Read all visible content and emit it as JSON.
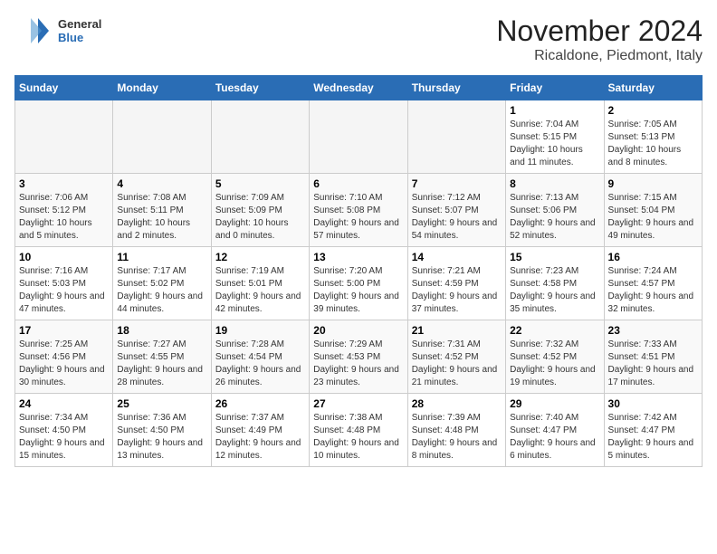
{
  "header": {
    "logo_general": "General",
    "logo_blue": "Blue",
    "month_title": "November 2024",
    "location": "Ricaldone, Piedmont, Italy"
  },
  "weekdays": [
    "Sunday",
    "Monday",
    "Tuesday",
    "Wednesday",
    "Thursday",
    "Friday",
    "Saturday"
  ],
  "weeks": [
    [
      {
        "day": "",
        "info": ""
      },
      {
        "day": "",
        "info": ""
      },
      {
        "day": "",
        "info": ""
      },
      {
        "day": "",
        "info": ""
      },
      {
        "day": "",
        "info": ""
      },
      {
        "day": "1",
        "info": "Sunrise: 7:04 AM\nSunset: 5:15 PM\nDaylight: 10 hours and 11 minutes."
      },
      {
        "day": "2",
        "info": "Sunrise: 7:05 AM\nSunset: 5:13 PM\nDaylight: 10 hours and 8 minutes."
      }
    ],
    [
      {
        "day": "3",
        "info": "Sunrise: 7:06 AM\nSunset: 5:12 PM\nDaylight: 10 hours and 5 minutes."
      },
      {
        "day": "4",
        "info": "Sunrise: 7:08 AM\nSunset: 5:11 PM\nDaylight: 10 hours and 2 minutes."
      },
      {
        "day": "5",
        "info": "Sunrise: 7:09 AM\nSunset: 5:09 PM\nDaylight: 10 hours and 0 minutes."
      },
      {
        "day": "6",
        "info": "Sunrise: 7:10 AM\nSunset: 5:08 PM\nDaylight: 9 hours and 57 minutes."
      },
      {
        "day": "7",
        "info": "Sunrise: 7:12 AM\nSunset: 5:07 PM\nDaylight: 9 hours and 54 minutes."
      },
      {
        "day": "8",
        "info": "Sunrise: 7:13 AM\nSunset: 5:06 PM\nDaylight: 9 hours and 52 minutes."
      },
      {
        "day": "9",
        "info": "Sunrise: 7:15 AM\nSunset: 5:04 PM\nDaylight: 9 hours and 49 minutes."
      }
    ],
    [
      {
        "day": "10",
        "info": "Sunrise: 7:16 AM\nSunset: 5:03 PM\nDaylight: 9 hours and 47 minutes."
      },
      {
        "day": "11",
        "info": "Sunrise: 7:17 AM\nSunset: 5:02 PM\nDaylight: 9 hours and 44 minutes."
      },
      {
        "day": "12",
        "info": "Sunrise: 7:19 AM\nSunset: 5:01 PM\nDaylight: 9 hours and 42 minutes."
      },
      {
        "day": "13",
        "info": "Sunrise: 7:20 AM\nSunset: 5:00 PM\nDaylight: 9 hours and 39 minutes."
      },
      {
        "day": "14",
        "info": "Sunrise: 7:21 AM\nSunset: 4:59 PM\nDaylight: 9 hours and 37 minutes."
      },
      {
        "day": "15",
        "info": "Sunrise: 7:23 AM\nSunset: 4:58 PM\nDaylight: 9 hours and 35 minutes."
      },
      {
        "day": "16",
        "info": "Sunrise: 7:24 AM\nSunset: 4:57 PM\nDaylight: 9 hours and 32 minutes."
      }
    ],
    [
      {
        "day": "17",
        "info": "Sunrise: 7:25 AM\nSunset: 4:56 PM\nDaylight: 9 hours and 30 minutes."
      },
      {
        "day": "18",
        "info": "Sunrise: 7:27 AM\nSunset: 4:55 PM\nDaylight: 9 hours and 28 minutes."
      },
      {
        "day": "19",
        "info": "Sunrise: 7:28 AM\nSunset: 4:54 PM\nDaylight: 9 hours and 26 minutes."
      },
      {
        "day": "20",
        "info": "Sunrise: 7:29 AM\nSunset: 4:53 PM\nDaylight: 9 hours and 23 minutes."
      },
      {
        "day": "21",
        "info": "Sunrise: 7:31 AM\nSunset: 4:52 PM\nDaylight: 9 hours and 21 minutes."
      },
      {
        "day": "22",
        "info": "Sunrise: 7:32 AM\nSunset: 4:52 PM\nDaylight: 9 hours and 19 minutes."
      },
      {
        "day": "23",
        "info": "Sunrise: 7:33 AM\nSunset: 4:51 PM\nDaylight: 9 hours and 17 minutes."
      }
    ],
    [
      {
        "day": "24",
        "info": "Sunrise: 7:34 AM\nSunset: 4:50 PM\nDaylight: 9 hours and 15 minutes."
      },
      {
        "day": "25",
        "info": "Sunrise: 7:36 AM\nSunset: 4:50 PM\nDaylight: 9 hours and 13 minutes."
      },
      {
        "day": "26",
        "info": "Sunrise: 7:37 AM\nSunset: 4:49 PM\nDaylight: 9 hours and 12 minutes."
      },
      {
        "day": "27",
        "info": "Sunrise: 7:38 AM\nSunset: 4:48 PM\nDaylight: 9 hours and 10 minutes."
      },
      {
        "day": "28",
        "info": "Sunrise: 7:39 AM\nSunset: 4:48 PM\nDaylight: 9 hours and 8 minutes."
      },
      {
        "day": "29",
        "info": "Sunrise: 7:40 AM\nSunset: 4:47 PM\nDaylight: 9 hours and 6 minutes."
      },
      {
        "day": "30",
        "info": "Sunrise: 7:42 AM\nSunset: 4:47 PM\nDaylight: 9 hours and 5 minutes."
      }
    ]
  ]
}
